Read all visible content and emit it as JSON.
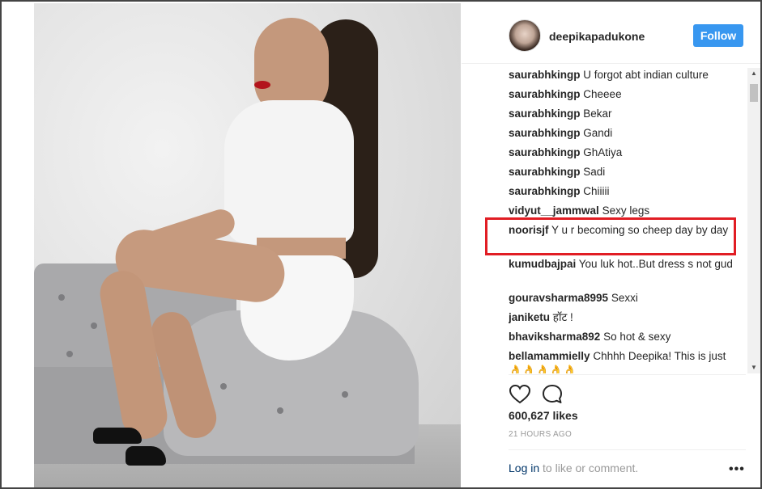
{
  "post": {
    "username": "deepikapadukone",
    "follow_label": "Follow",
    "likes": "600,627 likes",
    "time": "21 HOURS AGO",
    "login_link": "Log in",
    "login_suffix": " to like or comment.",
    "more": "•••"
  },
  "comments": [
    {
      "user": "saurabhkingp",
      "text": "U forgot abt indian culture"
    },
    {
      "user": "saurabhkingp",
      "text": "Cheeee"
    },
    {
      "user": "saurabhkingp",
      "text": "Bekar"
    },
    {
      "user": "saurabhkingp",
      "text": "Gandi"
    },
    {
      "user": "saurabhkingp",
      "text": "GhAtiya"
    },
    {
      "user": "saurabhkingp",
      "text": "Sadi"
    },
    {
      "user": "saurabhkingp",
      "text": "Chiiiii"
    },
    {
      "user": "vidyut__jammwal",
      "text": "Sexy legs"
    },
    {
      "user": "noorisjf",
      "text": "Y u r becoming so cheep day by day"
    },
    {
      "user": "kumudbajpai",
      "text": "You luk hot..But dress s not gud"
    },
    {
      "user": "gouravsharma8995",
      "text": "Sexxi"
    },
    {
      "user": "janiketu",
      "text": "हॉट !"
    },
    {
      "user": "bhaviksharma892",
      "text": "So hot & sexy"
    },
    {
      "user": "bellamammielly",
      "text": "Chhhh Deepika! This is just 👌👌👌👌👌"
    }
  ],
  "icons": {
    "like": "heart-icon",
    "comment": "comment-icon",
    "more": "more-icon"
  },
  "colors": {
    "follow_button": "#3897f0",
    "highlight_box": "#e11d24",
    "login_link": "#003569"
  }
}
